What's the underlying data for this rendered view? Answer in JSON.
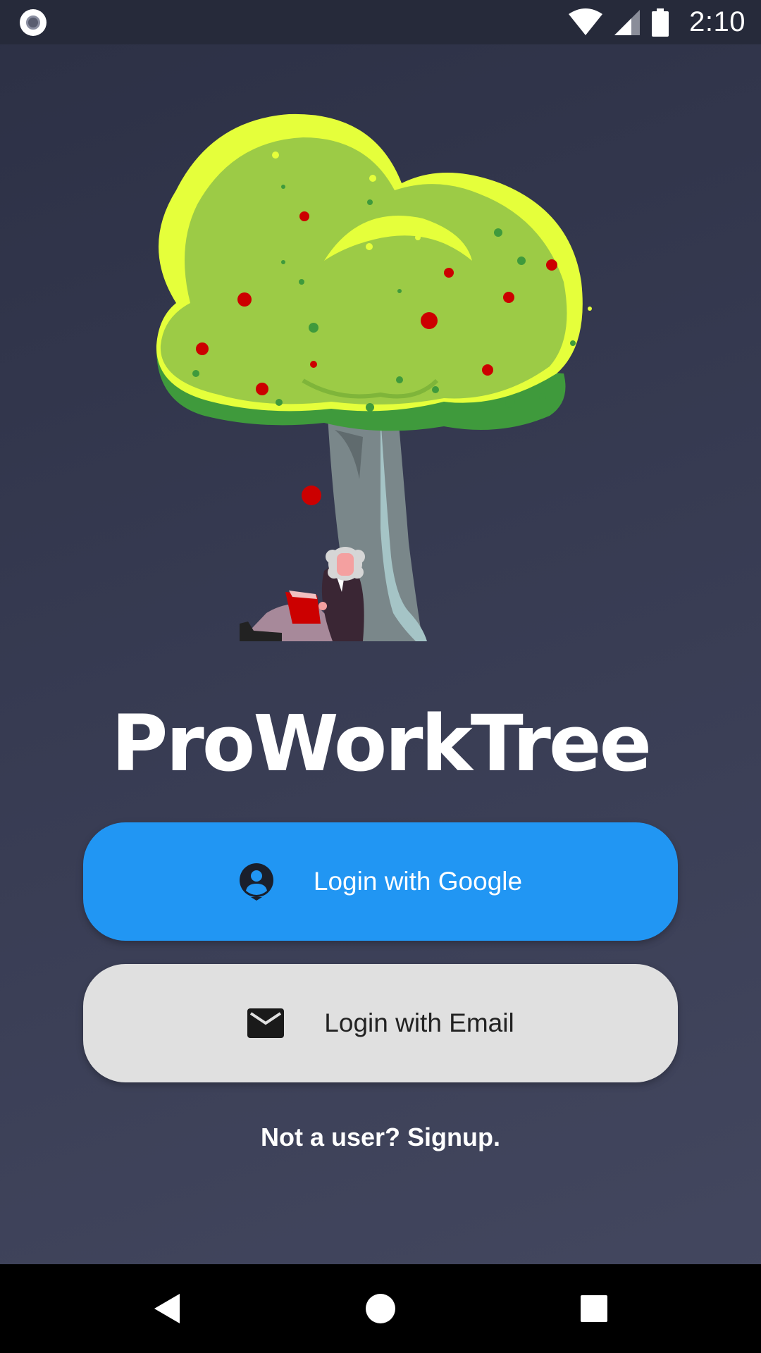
{
  "status_bar": {
    "time": "2:10",
    "icons": [
      "record-icon",
      "wifi-icon",
      "cell-signal-icon",
      "battery-icon"
    ]
  },
  "app": {
    "title": "ProWorkTree",
    "illustration": "tree-reader-illustration"
  },
  "login": {
    "google_label": "Login with Google",
    "google_icon": "account-icon",
    "email_label": "Login with Email",
    "email_icon": "mail-icon",
    "signup_text": "Not a user? Signup."
  },
  "colors": {
    "background": "#373b52",
    "google_button": "#2196f3",
    "email_button": "#e0e0e0",
    "foliage": "#9ccb46",
    "foliage_highlight": "#e5ff3b",
    "apple": "#cc0000"
  },
  "nav_bar": {
    "icons": [
      "back-icon",
      "home-icon",
      "recents-icon"
    ]
  }
}
